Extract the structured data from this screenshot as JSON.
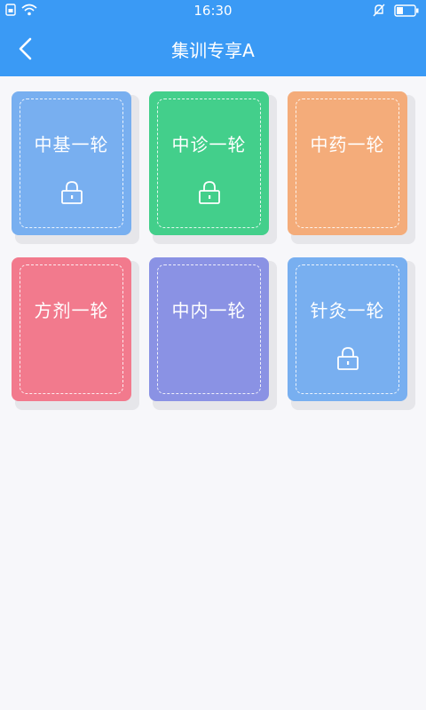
{
  "status_bar": {
    "time": "16:30",
    "icons": [
      "sim-icon",
      "wifi-icon",
      "mute-icon",
      "battery-icon"
    ]
  },
  "header": {
    "title": "集训专享A",
    "back_icon": "chevron-left-icon"
  },
  "colors": {
    "header": "#3a9af5",
    "background": "#f7f7fa",
    "card_blue": "#78aff0",
    "card_green": "#43cf8b",
    "card_orange": "#f4ac7a",
    "card_pink": "#f27a8d",
    "card_purple": "#8a92e4"
  },
  "cards": [
    {
      "label": "中基一轮",
      "locked": true,
      "color": "#78aff0"
    },
    {
      "label": "中诊一轮",
      "locked": true,
      "color": "#43cf8b"
    },
    {
      "label": "中药一轮",
      "locked": false,
      "color": "#f4ac7a"
    },
    {
      "label": "方剂一轮",
      "locked": false,
      "color": "#f27a8d"
    },
    {
      "label": "中内一轮",
      "locked": false,
      "color": "#8a92e4"
    },
    {
      "label": "针灸一轮",
      "locked": true,
      "color": "#78aff0"
    }
  ]
}
